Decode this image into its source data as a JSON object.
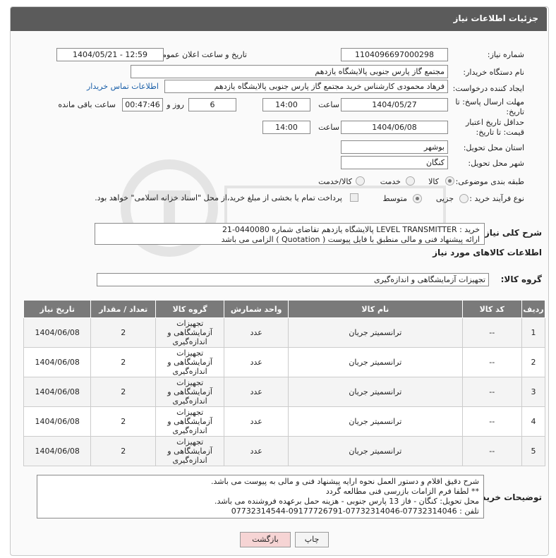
{
  "header": {
    "title": "جزئیات اطلاعات نیاز"
  },
  "fields": {
    "need_number_label": "شماره نیاز:",
    "need_number": "1104096697000298",
    "announce_label": "تاریخ و ساعت اعلان عمومی:",
    "announce_value": "1404/05/21 - 12:59",
    "buyer_org_label": "نام دستگاه خریدار:",
    "buyer_org": "مجتمع گاز پارس جنوبی  پالایشگاه یازدهم",
    "requester_label": "ایجاد کننده درخواست:",
    "requester": "فرهاد محمودی کارشناس خرید مجتمع گاز پارس جنوبی  پالایشگاه یازدهم",
    "contact_link": "اطلاعات تماس خریدار",
    "deadline_label": "مهلت ارسال پاسخ: تا تاریخ:",
    "deadline_date": "1404/05/27",
    "time_label": "ساعت",
    "deadline_time": "14:00",
    "days_value": "6",
    "days_label": "روز و",
    "remaining_time": "00:47:46",
    "remaining_label": "ساعت باقی مانده",
    "validity_label": "حداقل تاریخ اعتبار قیمت: تا تاریخ:",
    "validity_date": "1404/06/08",
    "validity_time": "14:00",
    "province_label": "استان محل تحویل:",
    "province": "بوشهر",
    "city_label": "شهر محل تحویل:",
    "city": "کنگان",
    "category_label": "طبقه بندی موضوعی:",
    "category_options": [
      "کالا",
      "خدمت",
      "کالا/خدمت"
    ],
    "process_label": "نوع فرآیند خرید :",
    "process_options": [
      "جزیی",
      "متوسط"
    ],
    "payment_note": "پرداخت تمام یا بخشی از مبلغ خرید،از محل \"اسناد خزانه اسلامی\" خواهد بود."
  },
  "description": {
    "label": "شرح کلی نیاز:",
    "line1": "خرید : LEVEL TRANSMITTER  پالایشگاه یازدهم تقاضای شماره 0440080-21",
    "line2": "ارائه پیشنهاد فنی و مالی منطبق با فایل پیوست ( Quotation ) الزامی می باشد"
  },
  "goods": {
    "section_title": "اطلاعات کالاهای مورد نیاز",
    "group_label": "گروه کالا:",
    "group_value": "تجهیزات آزمایشگاهی و اندازه‌گیری",
    "columns": [
      "ردیف",
      "کد کالا",
      "نام کالا",
      "واحد شمارش",
      "گروه کالا",
      "تعداد / مقدار",
      "تاریخ نیاز"
    ],
    "rows": [
      {
        "idx": "1",
        "code": "--",
        "name": "ترانسمیتر جریان",
        "unit": "عدد",
        "group": "تجهیزات آزمایشگاهی و اندازه‌گیری",
        "qty": "2",
        "date": "1404/06/08"
      },
      {
        "idx": "2",
        "code": "--",
        "name": "ترانسمیتر جریان",
        "unit": "عدد",
        "group": "تجهیزات آزمایشگاهی و اندازه‌گیری",
        "qty": "2",
        "date": "1404/06/08"
      },
      {
        "idx": "3",
        "code": "--",
        "name": "ترانسمیتر جریان",
        "unit": "عدد",
        "group": "تجهیزات آزمایشگاهی و اندازه‌گیری",
        "qty": "2",
        "date": "1404/06/08"
      },
      {
        "idx": "4",
        "code": "--",
        "name": "ترانسمیتر جریان",
        "unit": "عدد",
        "group": "تجهیزات آزمایشگاهی و اندازه‌گیری",
        "qty": "2",
        "date": "1404/06/08"
      },
      {
        "idx": "5",
        "code": "--",
        "name": "ترانسمیتر جریان",
        "unit": "عدد",
        "group": "تجهیزات آزمایشگاهی و اندازه‌گیری",
        "qty": "2",
        "date": "1404/06/08"
      }
    ]
  },
  "buyer_notes": {
    "label": "توضیحات خریدار:",
    "line1": "شرح دقیق اقلام و دستور العمل نحوه ارایه پیشنهاد فنی و مالی به پیوست می باشد.",
    "line2": "** لطفا فرم الزامات بازرسی فنی مطالعه گردد",
    "line3": "محل تحویل: کنگان - فاز 13 پارس جنوبی - هزینه حمل برعهده فروشنده می باشد.",
    "line4": "تلفن : 07732314046-07732314046-09177726791-07732314544"
  },
  "buttons": {
    "print": "چاپ",
    "back": "بازگشت"
  },
  "colors": {
    "header_bg": "#5b5b5b",
    "link": "#1a5fa8",
    "back_btn": "#f6d4d4"
  }
}
